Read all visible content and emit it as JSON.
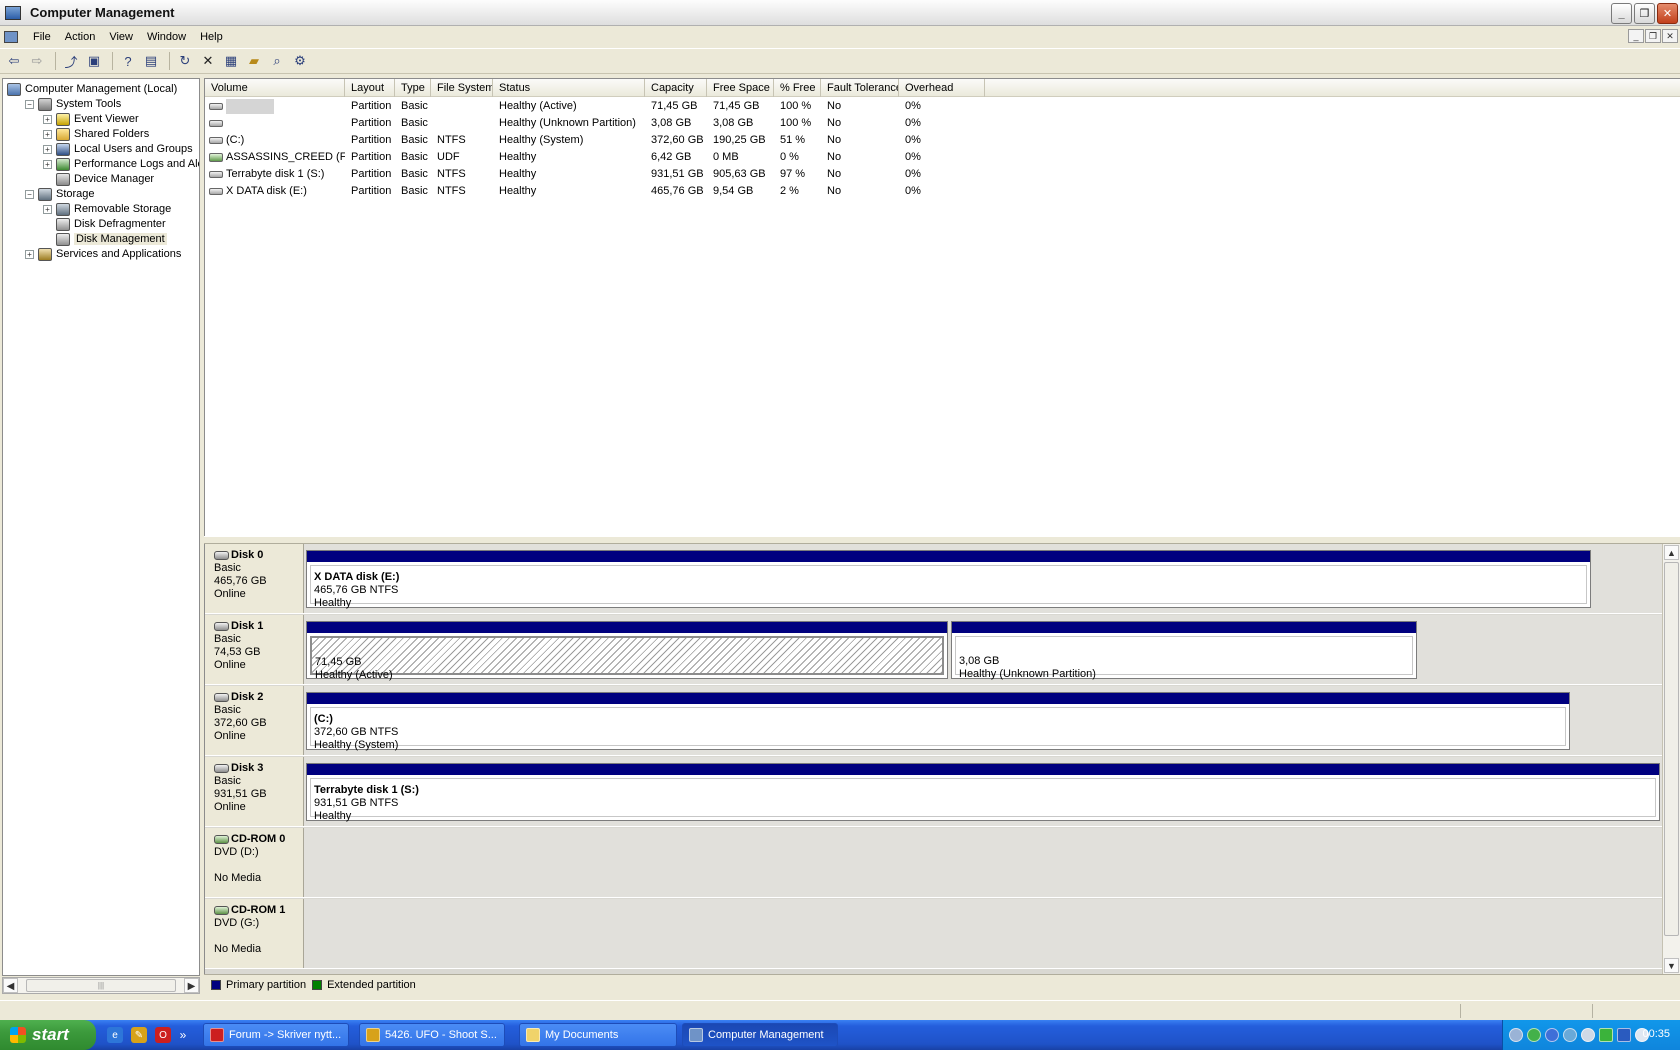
{
  "window": {
    "title": "Computer Management"
  },
  "menu": {
    "items": [
      "File",
      "Action",
      "View",
      "Window",
      "Help"
    ]
  },
  "tree": {
    "items": [
      {
        "label": "Computer Management (Local)",
        "level": 0,
        "expander": "",
        "icon": "computer-icon"
      },
      {
        "label": "System Tools",
        "level": 1,
        "expander": "−",
        "icon": "tools-icon"
      },
      {
        "label": "Event Viewer",
        "level": 2,
        "expander": "+",
        "icon": "event-viewer-icon"
      },
      {
        "label": "Shared Folders",
        "level": 2,
        "expander": "+",
        "icon": "shared-folder-icon"
      },
      {
        "label": "Local Users and Groups",
        "level": 2,
        "expander": "+",
        "icon": "users-icon"
      },
      {
        "label": "Performance Logs and Alerts",
        "level": 2,
        "expander": "+",
        "icon": "performance-icon"
      },
      {
        "label": "Device Manager",
        "level": 2,
        "expander": "",
        "icon": "device-manager-icon"
      },
      {
        "label": "Storage",
        "level": 1,
        "expander": "−",
        "icon": "storage-icon"
      },
      {
        "label": "Removable Storage",
        "level": 2,
        "expander": "+",
        "icon": "removable-storage-icon"
      },
      {
        "label": "Disk Defragmenter",
        "level": 2,
        "expander": "",
        "icon": "defragmenter-icon"
      },
      {
        "label": "Disk Management",
        "level": 2,
        "expander": "",
        "icon": "disk-management-icon",
        "selected": true
      },
      {
        "label": "Services and Applications",
        "level": 1,
        "expander": "+",
        "icon": "services-icon"
      }
    ]
  },
  "volumes": {
    "columns": [
      "Volume",
      "Layout",
      "Type",
      "File System",
      "Status",
      "Capacity",
      "Free Space",
      "% Free",
      "Fault Tolerance",
      "Overhead"
    ],
    "rows": [
      {
        "volume": "",
        "redacted": true,
        "layout": "Partition",
        "type": "Basic",
        "fs": "",
        "status": "Healthy (Active)",
        "capacity": "71,45 GB",
        "free": "71,45 GB",
        "pct": "100 %",
        "fault": "No",
        "overhead": "0%"
      },
      {
        "volume": "",
        "layout": "Partition",
        "type": "Basic",
        "fs": "",
        "status": "Healthy (Unknown Partition)",
        "capacity": "3,08 GB",
        "free": "3,08 GB",
        "pct": "100 %",
        "fault": "No",
        "overhead": "0%"
      },
      {
        "volume": "(C:)",
        "layout": "Partition",
        "type": "Basic",
        "fs": "NTFS",
        "status": "Healthy (System)",
        "capacity": "372,60 GB",
        "free": "190,25 GB",
        "pct": "51 %",
        "fault": "No",
        "overhead": "0%"
      },
      {
        "volume": "ASSASSINS_CREED (F:)",
        "cd": true,
        "layout": "Partition",
        "type": "Basic",
        "fs": "UDF",
        "status": "Healthy",
        "capacity": "6,42 GB",
        "free": "0 MB",
        "pct": "0 %",
        "fault": "No",
        "overhead": "0%"
      },
      {
        "volume": "Terrabyte disk 1 (S:)",
        "layout": "Partition",
        "type": "Basic",
        "fs": "NTFS",
        "status": "Healthy",
        "capacity": "931,51 GB",
        "free": "905,63 GB",
        "pct": "97 %",
        "fault": "No",
        "overhead": "0%"
      },
      {
        "volume": "X DATA disk (E:)",
        "layout": "Partition",
        "type": "Basic",
        "fs": "NTFS",
        "status": "Healthy",
        "capacity": "465,76 GB",
        "free": "9,54 GB",
        "pct": "2 %",
        "fault": "No",
        "overhead": "0%"
      }
    ]
  },
  "disks": [
    {
      "name": "Disk 0",
      "type": "Basic",
      "size": "465,76 GB",
      "state": "Online",
      "cd": false,
      "partitions": [
        {
          "name": "X DATA disk  (E:)",
          "size": "465,76 GB NTFS",
          "status": "Healthy"
        }
      ]
    },
    {
      "name": "Disk 1",
      "type": "Basic",
      "size": "74,53 GB",
      "state": "Online",
      "cd": false,
      "partitions": [
        {
          "name": "",
          "size": "71,45 GB",
          "status": "Healthy (Active)",
          "hatched": true
        },
        {
          "name": "",
          "size": "3,08 GB",
          "status": "Healthy (Unknown Partition)"
        }
      ]
    },
    {
      "name": "Disk 2",
      "type": "Basic",
      "size": "372,60 GB",
      "state": "Online",
      "cd": false,
      "partitions": [
        {
          "name": "(C:)",
          "size": "372,60 GB NTFS",
          "status": "Healthy (System)"
        }
      ]
    },
    {
      "name": "Disk 3",
      "type": "Basic",
      "size": "931,51 GB",
      "state": "Online",
      "cd": false,
      "partitions": [
        {
          "name": "Terrabyte disk 1  (S:)",
          "size": "931,51 GB NTFS",
          "status": "Healthy"
        }
      ]
    },
    {
      "name": "CD-ROM 0",
      "type": "DVD (D:)",
      "size": "",
      "state": "No Media",
      "cd": true,
      "partitions": []
    },
    {
      "name": "CD-ROM 1",
      "type": "DVD (G:)",
      "size": "",
      "state": "No Media",
      "cd": true,
      "partitions": []
    }
  ],
  "legend": {
    "items": [
      {
        "label": "Primary partition",
        "color": "#00007f"
      },
      {
        "label": "Extended partition",
        "color": "#008000"
      }
    ]
  },
  "taskbar": {
    "start_label": "start",
    "tasks": [
      "Forum -> Skriver nytt...",
      "5426. UFO - Shoot S...",
      "My Documents",
      "Computer Management"
    ],
    "clock": "00:35"
  }
}
